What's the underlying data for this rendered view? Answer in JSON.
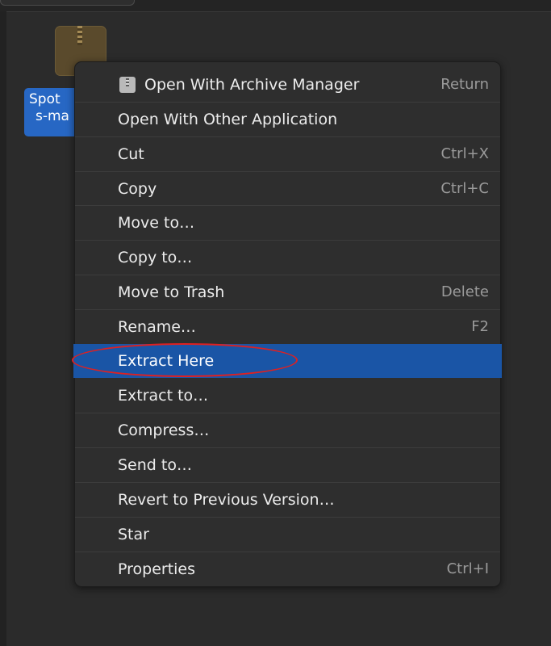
{
  "desktop": {
    "file": {
      "icon": "archive-zip-icon",
      "label_line1": "Spot",
      "label_line2": "s-ma"
    }
  },
  "context_menu": {
    "items": [
      {
        "label": "Open With Archive Manager",
        "accel": "Return",
        "icon": "archive-manager-icon"
      },
      {
        "label": "Open With Other Application",
        "accel": ""
      },
      {
        "label": "Cut",
        "accel": "Ctrl+X"
      },
      {
        "label": "Copy",
        "accel": "Ctrl+C"
      },
      {
        "label": "Move to…",
        "accel": ""
      },
      {
        "label": "Copy to…",
        "accel": ""
      },
      {
        "label": "Move to Trash",
        "accel": "Delete"
      },
      {
        "label": "Rename…",
        "accel": "F2"
      },
      {
        "label": "Extract Here",
        "accel": "",
        "highlighted": true
      },
      {
        "label": "Extract to…",
        "accel": ""
      },
      {
        "label": "Compress…",
        "accel": ""
      },
      {
        "label": "Send to…",
        "accel": ""
      },
      {
        "label": "Revert to Previous Version…",
        "accel": ""
      },
      {
        "label": "Star",
        "accel": ""
      },
      {
        "label": "Properties",
        "accel": "Ctrl+I"
      }
    ]
  },
  "colors": {
    "menu_bg": "#2e2e2e",
    "highlight": "#1a55a6",
    "selection_label": "#2767c4",
    "annotation": "#e02020"
  }
}
